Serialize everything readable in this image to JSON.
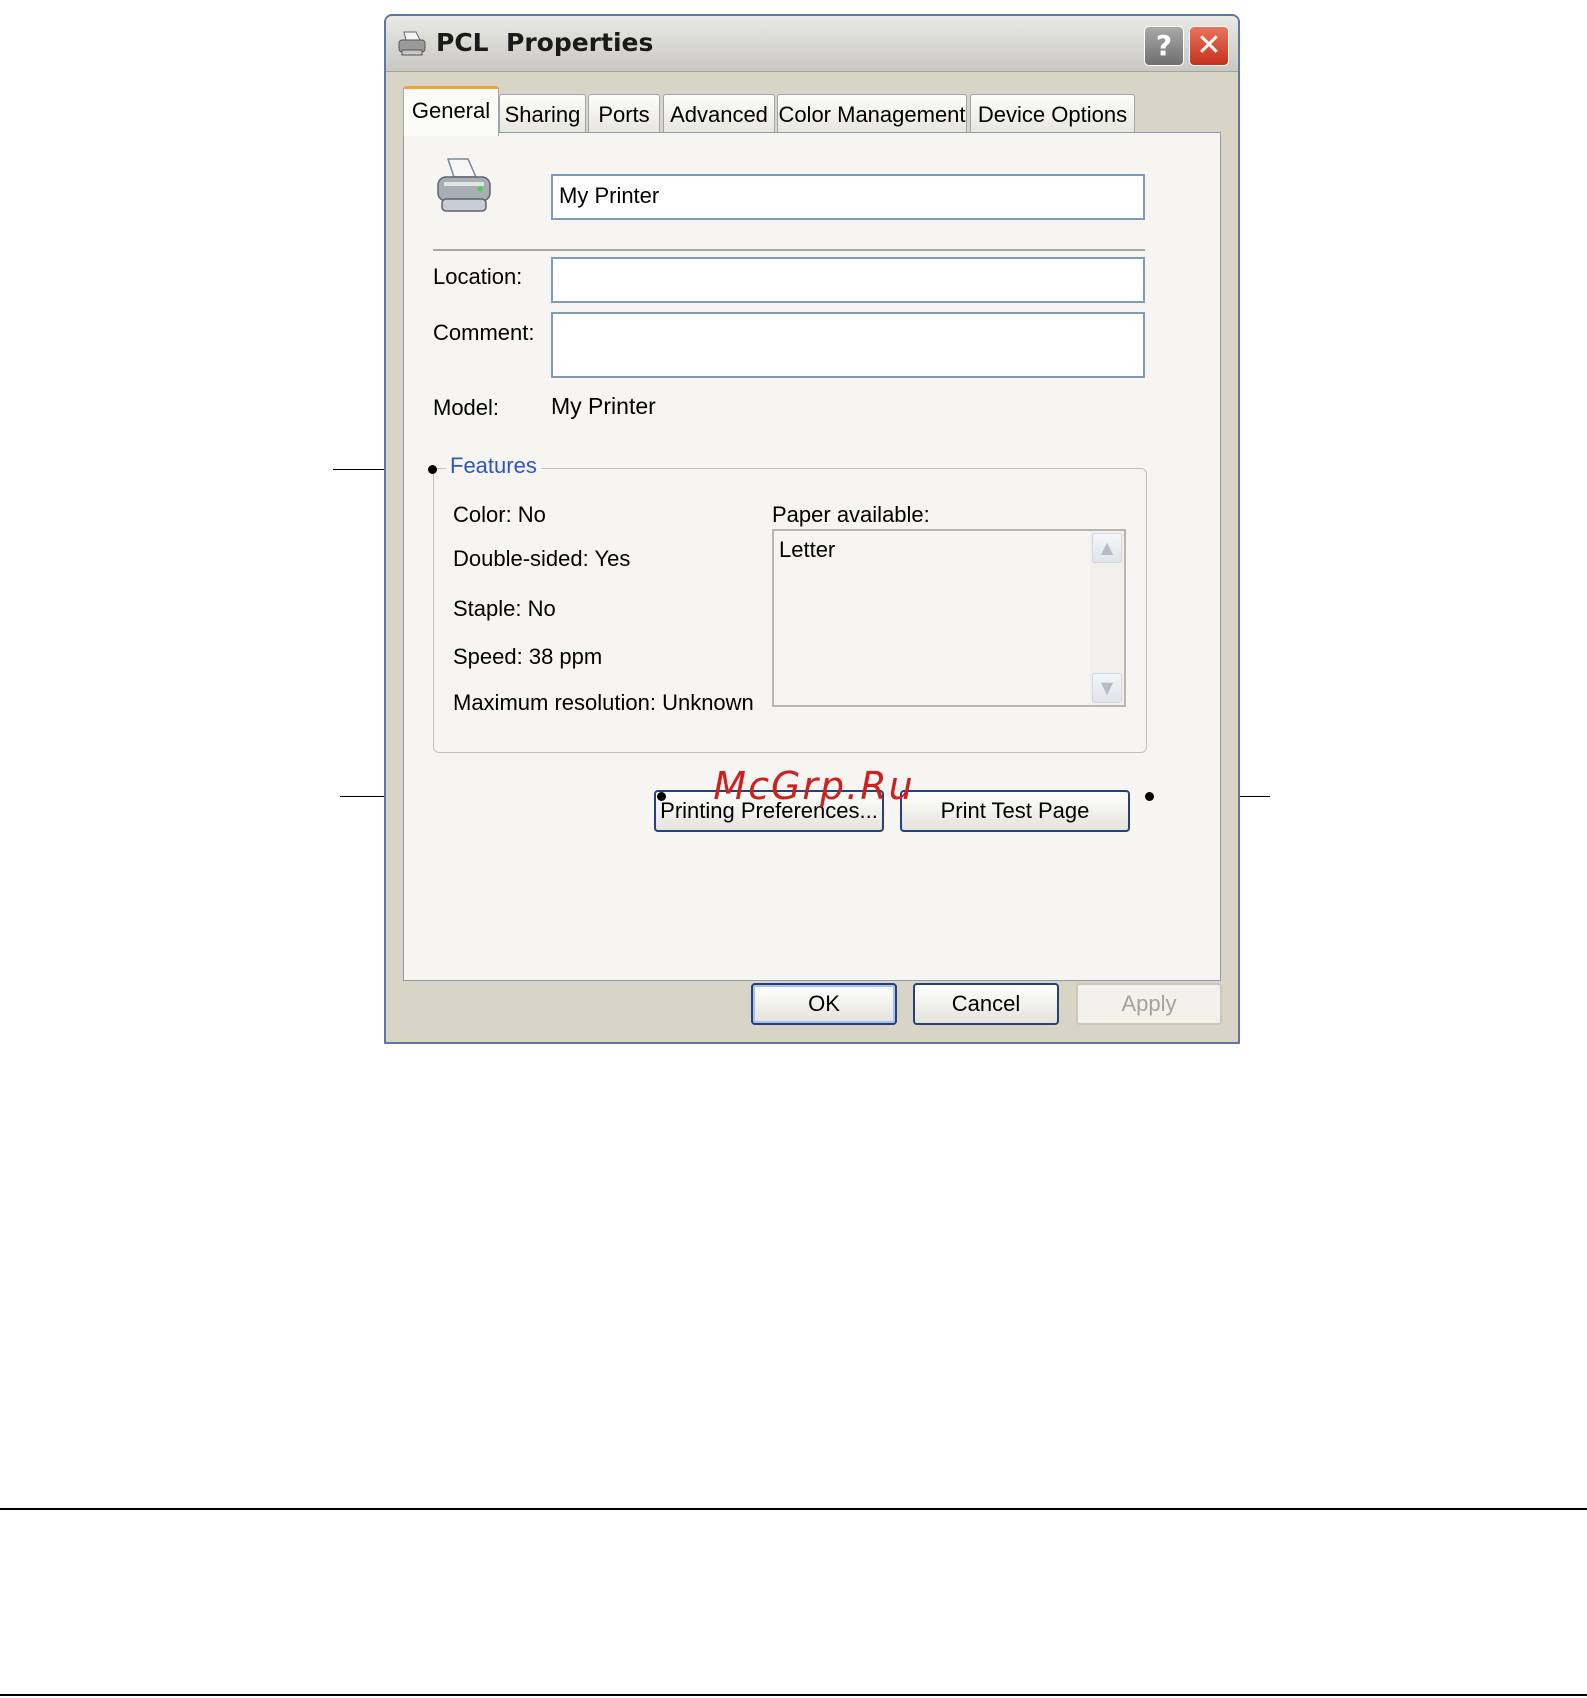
{
  "window": {
    "title": "PCL  Properties",
    "help_label": "?",
    "close_label": "✕"
  },
  "tabs": [
    {
      "label": "General",
      "active": true
    },
    {
      "label": "Sharing"
    },
    {
      "label": "Ports"
    },
    {
      "label": "Advanced"
    },
    {
      "label": "Color Management"
    },
    {
      "label": "Device Options"
    }
  ],
  "general": {
    "printer_name": "My Printer",
    "location_label": "Location:",
    "location_value": "",
    "comment_label": "Comment:",
    "comment_value": "",
    "model_label": "Model:",
    "model_value": "My Printer"
  },
  "features": {
    "title": "Features",
    "color": "Color: No",
    "double_sided": "Double-sided: Yes",
    "staple": "Staple: No",
    "speed": "Speed: 38 ppm",
    "max_resolution": "Maximum resolution: Unknown",
    "paper_label": "Paper available:",
    "paper_items": [
      "Letter"
    ]
  },
  "buttons": {
    "printing_preferences": "Printing Preferences...",
    "print_test_page": "Print Test Page",
    "ok": "OK",
    "cancel": "Cancel",
    "apply": "Apply"
  },
  "watermark": "McGrp.Ru",
  "icons": {
    "printer": "printer-icon",
    "scroll_up": "scroll-up-arrow-icon",
    "scroll_down": "scroll-down-arrow-icon"
  }
}
